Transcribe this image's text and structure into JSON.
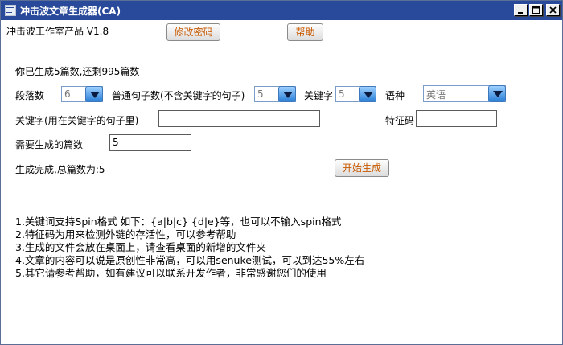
{
  "window": {
    "title": "冲击波文章生成器(CA)",
    "minimize_label": "_",
    "maximize_label": "□",
    "close_label": "×"
  },
  "header": {
    "product": "冲击波工作室产品 V1.8",
    "change_password_label": "修改密码",
    "help_label": "帮助"
  },
  "status": {
    "summary": "你已生成5篇数,还剩995篇数",
    "done": "生成完成,总篇数为:5"
  },
  "form": {
    "paragraphs_label": "段落数",
    "paragraphs_value": "6",
    "normal_sentences_label": "普通句子数(不含关键字的句子)",
    "normal_sentences_value": "5",
    "keywords_count_label": "关键字",
    "keywords_count_value": "5",
    "language_label": "语种",
    "language_value": "英语",
    "keyword_sentence_label": "关键字(用在关键字的句子里)",
    "keyword_sentence_value": "",
    "feature_code_label": "特征码",
    "feature_code_value": "",
    "articles_label": "需要生成的篇数",
    "articles_value": "5",
    "generate_label": "开始生成"
  },
  "notes": [
    "1.关键词支持Spin格式    如下：{a|b|c} {d|e}等，也可以不输入spin格式",
    "2.特征码为用来检测外链的存活性，可以参考帮助",
    "3.生成的文件会放在桌面上，请查看桌面的新增的文件夹",
    "4.文章的内容可以说是原创性非常高，可以用senuke测试，可以到达55%左右",
    "5.其它请参考帮助，如有建议可以联系开发作者，非常感谢您们的使用"
  ],
  "colors": {
    "titlebar": "#294a9b",
    "button_text": "#c85a00",
    "combo_arrow": "#2a7fd6"
  }
}
